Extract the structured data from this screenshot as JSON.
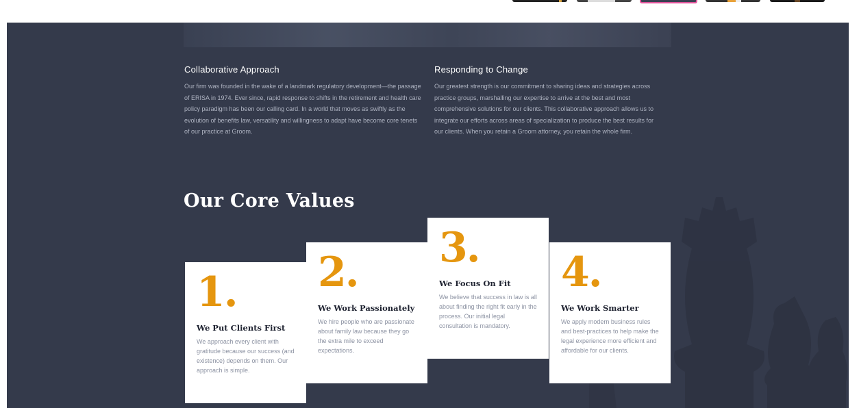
{
  "sections": {
    "collaborative": {
      "title": "Collaborative Approach",
      "text": "Our firm was founded in the wake of a landmark regulatory development—the passage of ERISA in 1974. Ever since, rapid response to shifts in the retirement and health care policy paradigm has been our calling card. In a world that moves as swiftly as the evolution of benefits law, versatility and willingness to adapt have become core tenets of our practice at Groom."
    },
    "responding": {
      "title": "Responding to Change",
      "text": "Our greatest strength is our commitment to sharing ideas and strategies across practice groups, marshalling our expertise to arrive at the best and most comprehensive solutions for our clients. This collaborative approach allows us to integrate our efforts across areas of specialization to produce the best results for our clients. When you retain a Groom attorney, you retain the whole firm."
    }
  },
  "core_values": {
    "heading": "Our Core Values",
    "cards": [
      {
        "number": "1.",
        "title": "We Put Clients First",
        "text": "We approach every client with gratitude because our success (and existence) depends on them. Our approach is simple."
      },
      {
        "number": "2.",
        "title": "We Work Passionately",
        "text": "We hire people who are passionate about family law because they go the extra mile to exceed expectations."
      },
      {
        "number": "3.",
        "title": "We Focus On Fit",
        "text": "We believe that success in law is all about finding the right fit early in the process. Our initial legal consultation is mandatory."
      },
      {
        "number": "4.",
        "title": "We Work Smarter",
        "text": "We apply modern business rules and best-practices to help make the legal experience more efficient and affordable for our clients."
      }
    ]
  },
  "colors": {
    "background": "#343a4b",
    "accent": "#e5960f",
    "card": "#ffffff",
    "body_text": "#aeb3c1"
  }
}
